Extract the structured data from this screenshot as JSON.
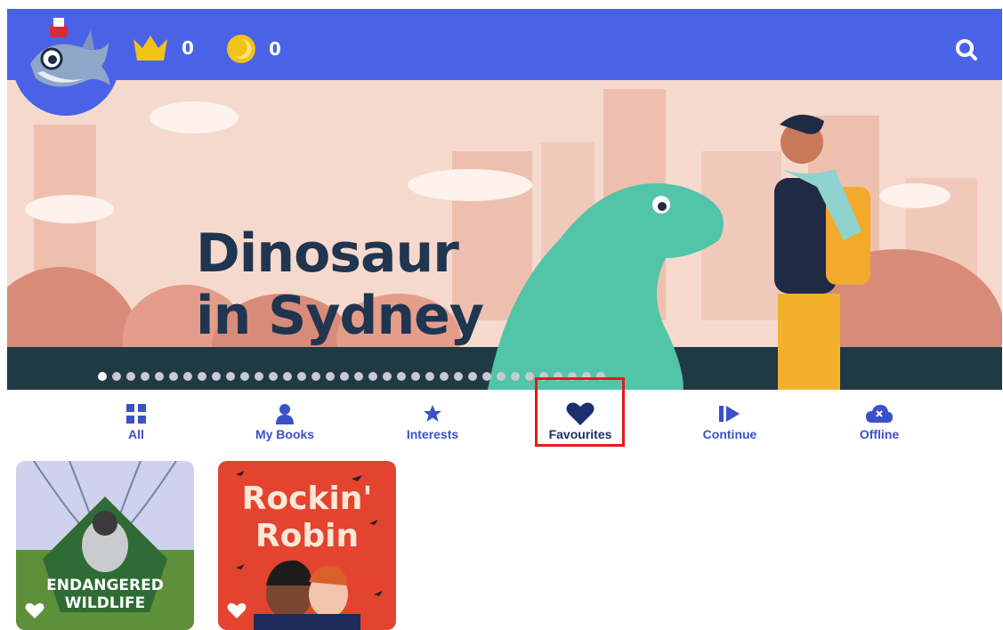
{
  "header": {
    "crowns": "0",
    "coins": "0",
    "colors": {
      "bar": "#4a63e6"
    }
  },
  "banner": {
    "title": "Dinosaur\nin Sydney",
    "slide_count": 36,
    "active_slide": 1
  },
  "tabs": [
    {
      "label": "All",
      "icon": "grid-icon"
    },
    {
      "label": "My Books",
      "icon": "person-icon"
    },
    {
      "label": "Interests",
      "icon": "star-icon"
    },
    {
      "label": "Favourites",
      "icon": "heart-icon",
      "selected": true
    },
    {
      "label": "Continue",
      "icon": "continue-icon"
    },
    {
      "label": "Offline",
      "icon": "cloud-icon"
    }
  ],
  "books": [
    {
      "title": "ENDANGERED\nWILDLIFE",
      "favourited": true
    },
    {
      "title": "Rockin'\nRobin",
      "favourited": true
    }
  ]
}
